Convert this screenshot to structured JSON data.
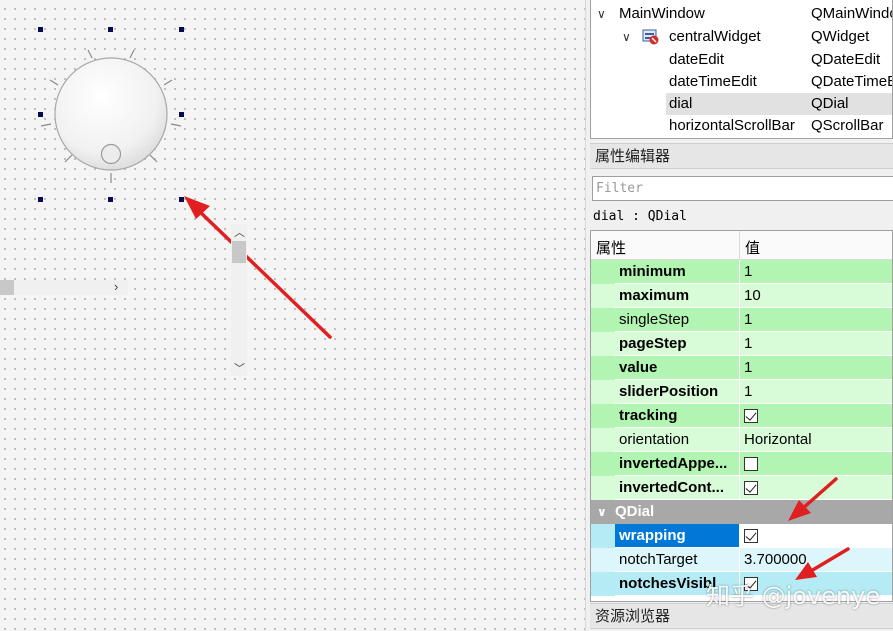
{
  "object_tree": {
    "rows": [
      {
        "name": "MainWindow",
        "class": "QMainWindow"
      },
      {
        "name": "centralWidget",
        "class": "QWidget"
      },
      {
        "name": "dateEdit",
        "class": "QDateEdit"
      },
      {
        "name": "dateTimeEdit",
        "class": "QDateTimeEdit"
      },
      {
        "name": "dial",
        "class": "QDial"
      },
      {
        "name": "horizontalScrollBar",
        "class": "QScrollBar"
      }
    ]
  },
  "property_editor": {
    "title": "属性编辑器",
    "filter_placeholder": "Filter",
    "object_label": "dial : QDial",
    "col_property": "属性",
    "col_value": "值",
    "rows": [
      {
        "name": "minimum",
        "value": "1"
      },
      {
        "name": "maximum",
        "value": "10"
      },
      {
        "name": "singleStep",
        "value": "1"
      },
      {
        "name": "pageStep",
        "value": "1"
      },
      {
        "name": "value",
        "value": "1"
      },
      {
        "name": "sliderPosition",
        "value": "1"
      },
      {
        "name": "tracking",
        "checked": true
      },
      {
        "name": "orientation",
        "value": "Horizontal"
      },
      {
        "name": "invertedAppe...",
        "checked": false
      },
      {
        "name": "invertedCont...",
        "checked": true
      }
    ],
    "group_label": "QDial",
    "dial_rows": [
      {
        "name": "wrapping",
        "checked": true
      },
      {
        "name": "notchTarget",
        "value": "3.700000"
      },
      {
        "name": "notchesVisibl",
        "checked": true
      }
    ]
  },
  "resource_browser": {
    "title": "资源浏览器"
  },
  "watermark": "知乎 @jovenye",
  "colors": {
    "property_green": "#b2f5b2",
    "property_green_light": "#d8fbd8",
    "property_cyan": "#b5ebf5",
    "property_cyan_light": "#dcf6fb",
    "selection": "#0078d7",
    "annotation_arrow": "#e02020"
  },
  "icons": {
    "expand": "chevron-down-icon",
    "widget": "qt-widget-icon",
    "scroll_right": "chevron-right-icon",
    "scroll_up": "chevron-up-icon",
    "scroll_down": "chevron-down-icon"
  }
}
